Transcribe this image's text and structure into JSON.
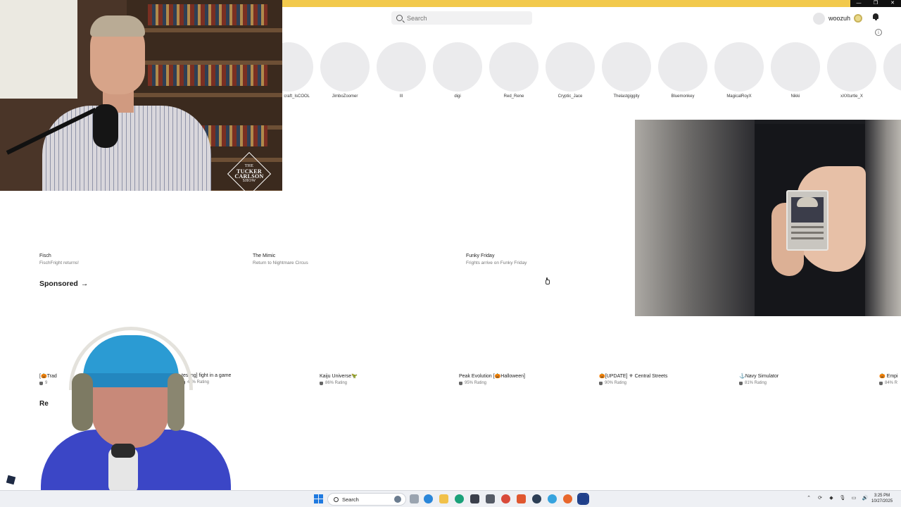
{
  "window": {
    "controls": [
      "minimize",
      "restore",
      "close"
    ],
    "accent_color": "#f2c94c"
  },
  "header": {
    "search_placeholder": "Search",
    "username": "woozuh"
  },
  "friends": [
    "craft_IsCOOL",
    "JimboZoomer",
    "lll",
    "digi",
    "Red_Rene",
    "Cryptic_Jace",
    "Thelastgiggity",
    "Bluemonkey",
    "MagicalRoyX",
    "Nikki",
    "xXXturtle_X"
  ],
  "events": [
    {
      "title": "Fisch",
      "subtitle": "FischFright returns!"
    },
    {
      "title": "The Mimic",
      "subtitle": "Return to Nightmare Circus"
    },
    {
      "title": "Funky Friday",
      "subtitle": "Frights arrive on Funky Friday"
    }
  ],
  "sponsored": {
    "label": "Sponsored",
    "arrow": "→"
  },
  "games": [
    {
      "title": "[🎃Trad",
      "rating": "9"
    },
    {
      "title": "testing] fight in a game",
      "rating": "41% Rating"
    },
    {
      "title": "Kaiju Universe🦖",
      "rating": "86% Rating"
    },
    {
      "title": "Peak Evolution [🎃Halloween]",
      "rating": "95% Rating"
    },
    {
      "title": "🎃[UPDATE] ⚜ Central Streets",
      "rating": "90% Rating"
    },
    {
      "title": "⚓Navy Simulator",
      "rating": "81% Rating"
    },
    {
      "title": "🎃 Empi",
      "rating": "84% R"
    }
  ],
  "recommended_heading": "Re",
  "webcam_badge": {
    "line1": "THE",
    "line2": "TUCKER",
    "line3": "CARLSON",
    "line4": "SHOW"
  },
  "taskbar": {
    "search_label": "Search",
    "time": "3:25 PM",
    "date": "10/27/2025",
    "apps": [
      "file-explorer-icon",
      "copilot-icon",
      "edge-icon",
      "store-icon",
      "snipping-icon",
      "chrome-icon",
      "brave-icon",
      "steam-icon",
      "telegram-icon",
      "firefox-icon",
      "roblox-icon"
    ]
  }
}
